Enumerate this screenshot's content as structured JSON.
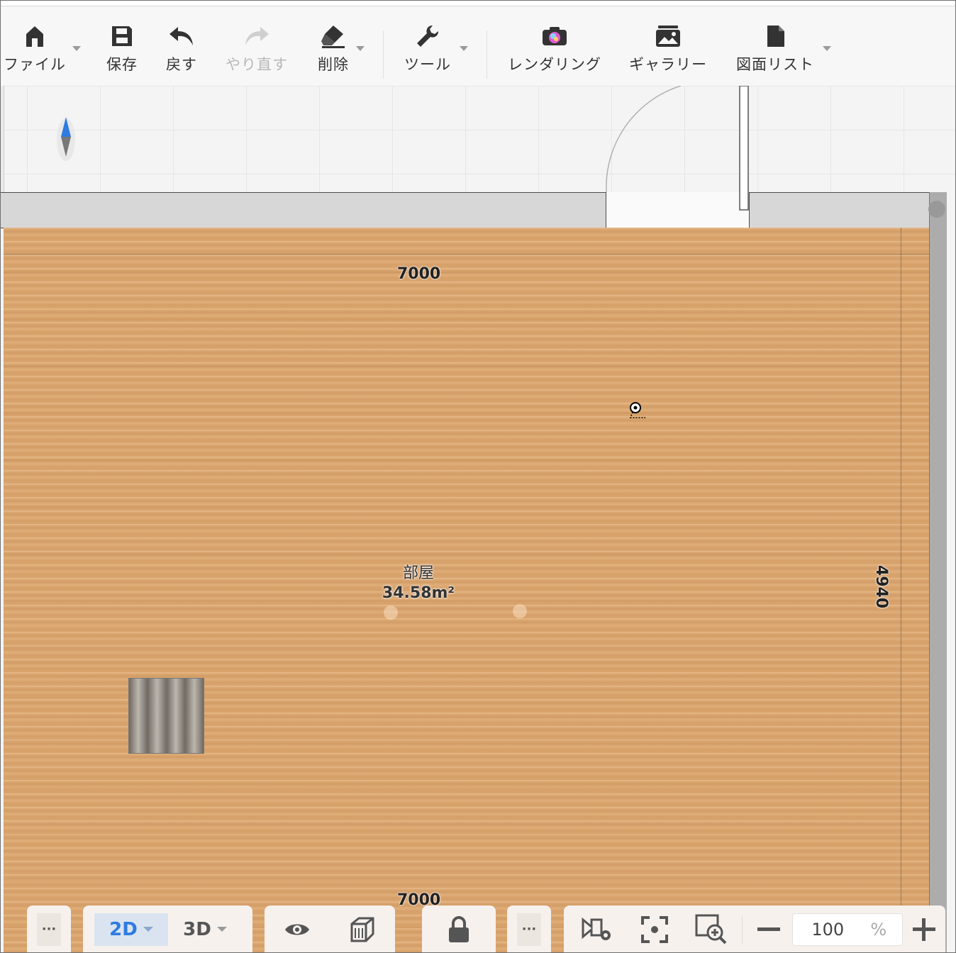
{
  "toolbar": {
    "file": "ファイル",
    "save": "保存",
    "undo": "戻す",
    "redo": "やり直す",
    "delete": "削除",
    "tools": "ツール",
    "rendering": "レンダリング",
    "gallery": "ギャラリー",
    "drawing_list": "図面リスト"
  },
  "plan": {
    "dim_top": "7000",
    "dim_bottom": "7000",
    "dim_right": "4940",
    "room_name": "部屋",
    "room_area": "34.58m²"
  },
  "bottom": {
    "more1": "···",
    "view_2d": "2D",
    "view_3d": "3D",
    "more2": "···",
    "zoom_value": "100",
    "zoom_unit": "%"
  },
  "colors": {
    "floor": "#d9a46e",
    "accent": "#2f7be0"
  }
}
